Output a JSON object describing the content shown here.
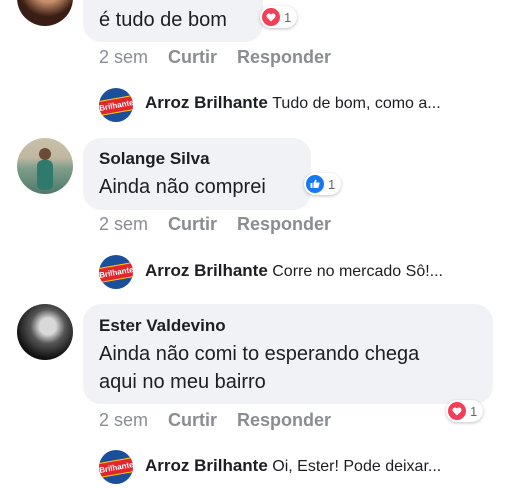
{
  "comments": [
    {
      "text": "é tudo de bom",
      "reaction": {
        "type": "heart",
        "count": "1"
      },
      "time": "2 sem",
      "like_label": "Curtir",
      "reply_label": "Responder",
      "reply": {
        "author": "Arroz Brilhante",
        "text": "Tudo de bom, como a..."
      }
    },
    {
      "author": "Solange Silva",
      "text": "Ainda não comprei",
      "reaction": {
        "type": "like",
        "count": "1"
      },
      "time": "2 sem",
      "like_label": "Curtir",
      "reply_label": "Responder",
      "reply": {
        "author": "Arroz Brilhante",
        "text": "Corre no mercado Sô!..."
      }
    },
    {
      "author": "Ester Valdevino",
      "text_line1": "Ainda não comi to esperando chega",
      "text_line2": "aqui no meu bairro",
      "reaction": {
        "type": "heart",
        "count": "1"
      },
      "time": "2 sem",
      "like_label": "Curtir",
      "reply_label": "Responder",
      "reply": {
        "author": "Arroz Brilhante",
        "text": "Oi, Ester! Pode deixar..."
      }
    }
  ],
  "brand_logo_text": "Brilhante",
  "colors": {
    "bubble": "#f0f2f5",
    "meta": "#8a8d91",
    "heart": "#f33e58",
    "like": "#1877f2",
    "logo_bg": "#1b4e9b"
  }
}
